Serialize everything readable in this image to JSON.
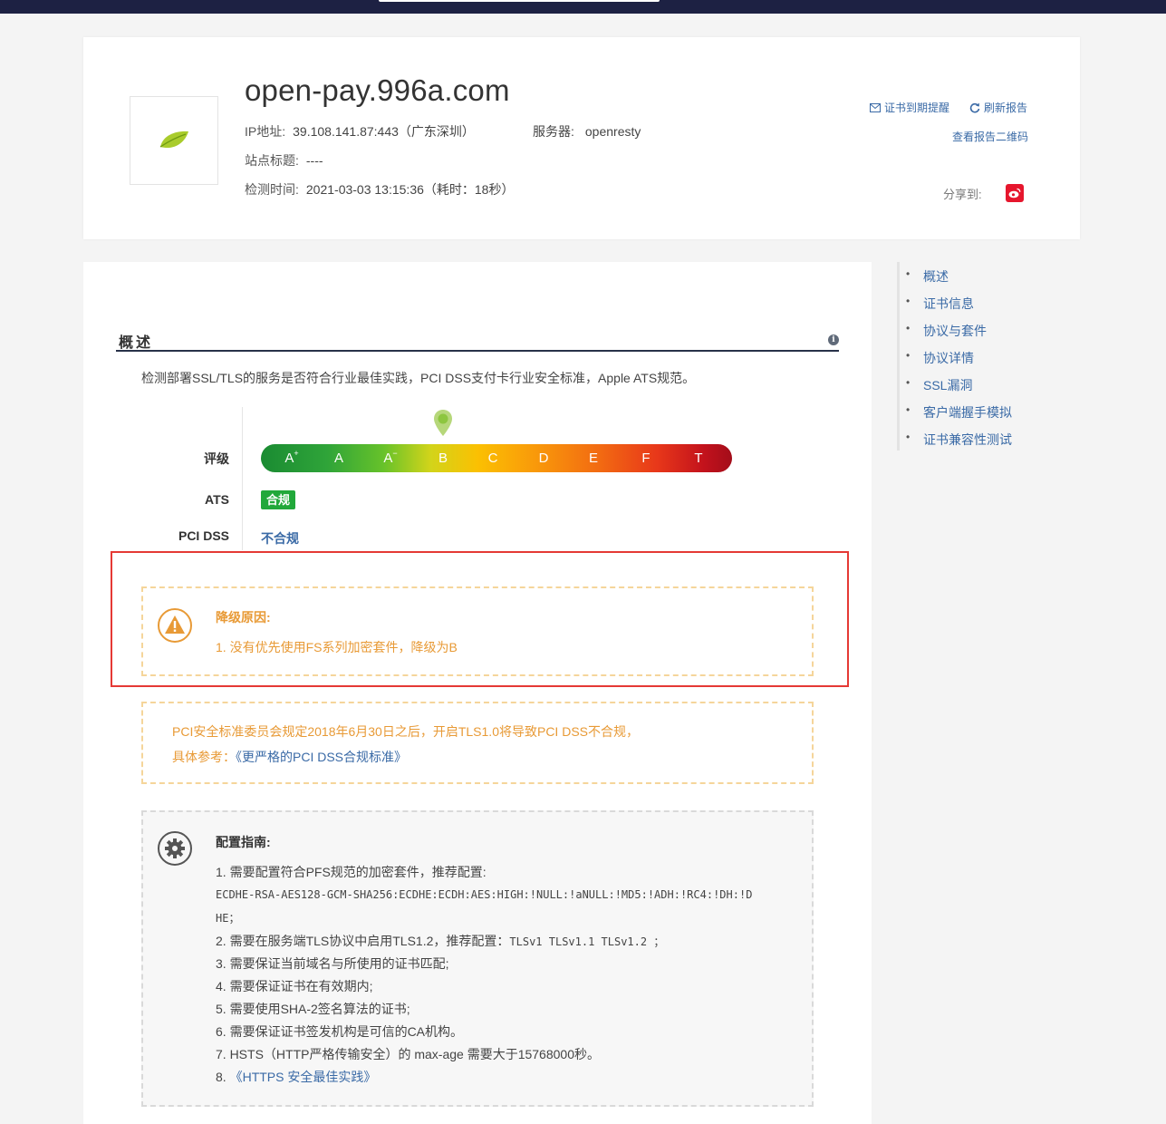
{
  "header": {
    "domain": "open-pay.996a.com",
    "ip_label": "IP地址:",
    "ip_value": "39.108.141.87:443（广东深圳）",
    "server_label": "服务器:",
    "server_value": "openresty",
    "site_title_label": "站点标题:",
    "site_title_value": "----",
    "check_time_label": "检测时间:",
    "check_time_value": "2021-03-03 13:15:36（耗时：18秒）",
    "cert_alert": "证书到期提醒",
    "refresh_report": "刷新报告",
    "qr_code": "查看报告二维码",
    "share_label": "分享到:",
    "share_icon": "weibo-icon"
  },
  "overview": {
    "title": "概述",
    "description": "检测部署SSL/TLS的服务是否符合行业最佳实践，PCI DSS支付卡行业安全标准，Apple ATS规范。",
    "rating_label": "评级",
    "ats_label": "ATS",
    "ats_value": "合规",
    "pci_label": "PCI DSS",
    "pci_value": "不合规",
    "grades": [
      "A",
      "A",
      "A",
      "B",
      "C",
      "D",
      "E",
      "F",
      "T"
    ],
    "grade_marks": [
      "+",
      "",
      "−",
      "",
      "",
      "",
      "",
      "",
      ""
    ],
    "current_grade": "B",
    "colors": {
      "ok_green": "#21a83a",
      "warn_orange": "#e89a36",
      "link_blue": "#3a6aa6",
      "highlight_red": "#e53935"
    }
  },
  "downgrade": {
    "title": "降级原因:",
    "reason": "1. 没有优先使用FS系列加密套件，降级为B"
  },
  "pci_notice": {
    "line1": "PCI安全标准委员会规定2018年6月30日之后，开启TLS1.0将导致PCI DSS不合规，",
    "line2_prefix": "具体参考：",
    "line2_link": "《更严格的PCI DSS合规标准》"
  },
  "guide": {
    "title": "配置指南:",
    "item1": "1. 需要配置符合PFS规范的加密套件，推荐配置:",
    "item1_code_a": "ECDHE-RSA-AES128-GCM-SHA256:ECDHE:ECDH:AES:HIGH:!NULL:!aNULL:!MD5:!ADH:!RC4:!DH:!D",
    "item1_code_b": "HE；",
    "item2_prefix": "2. 需要在服务端TLS协议中启用TLS1.2，推荐配置：",
    "item2_code": "TLSv1 TLSv1.1 TLSv1.2 ；",
    "item3": "3. 需要保证当前域名与所使用的证书匹配;",
    "item4": "4. 需要保证证书在有效期内;",
    "item5": "5. 需要使用SHA-2签名算法的证书;",
    "item6": "6. 需要保证证书签发机构是可信的CA机构。",
    "item7": "7. HSTS（HTTP严格传输安全）的 max-age 需要大于15768000秒。",
    "item8_prefix": "8. ",
    "item8_link": "《HTTPS 安全最佳实践》"
  },
  "side_nav": [
    "概述",
    "证书信息",
    "协议与套件",
    "协议详情",
    "SSL漏洞",
    "客户端握手模拟",
    "证书兼容性测试"
  ]
}
